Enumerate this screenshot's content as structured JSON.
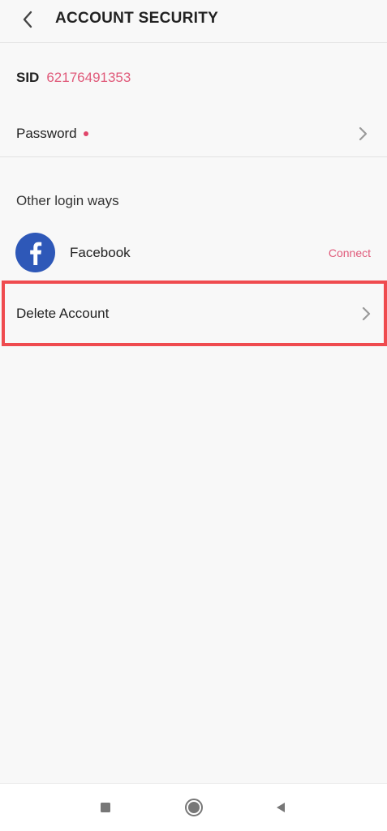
{
  "header": {
    "title": "ACCOUNT SECURITY",
    "back_icon": "chevron-left-icon"
  },
  "account": {
    "sid_label": "SID",
    "sid_value": "62176491353"
  },
  "password": {
    "label": "Password",
    "has_alert_dot": true,
    "chevron_icon": "chevron-right-icon"
  },
  "other_login": {
    "heading": "Other login ways",
    "providers": [
      {
        "name": "Facebook",
        "icon": "facebook-icon",
        "action_label": "Connect"
      }
    ]
  },
  "delete_account": {
    "label": "Delete Account",
    "chevron_icon": "chevron-right-icon",
    "highlight": true
  },
  "navbar": {
    "icons": [
      "recents-square-icon",
      "home-circle-icon",
      "back-triangle-icon"
    ]
  },
  "colors": {
    "accent_pink": "#e05a7a",
    "alert_dot": "#e0466a",
    "facebook_blue": "#2e58b8",
    "highlight_red": "#ef4b4f",
    "background": "#f8f8f8",
    "chevron_gray": "#9a9a9a"
  }
}
